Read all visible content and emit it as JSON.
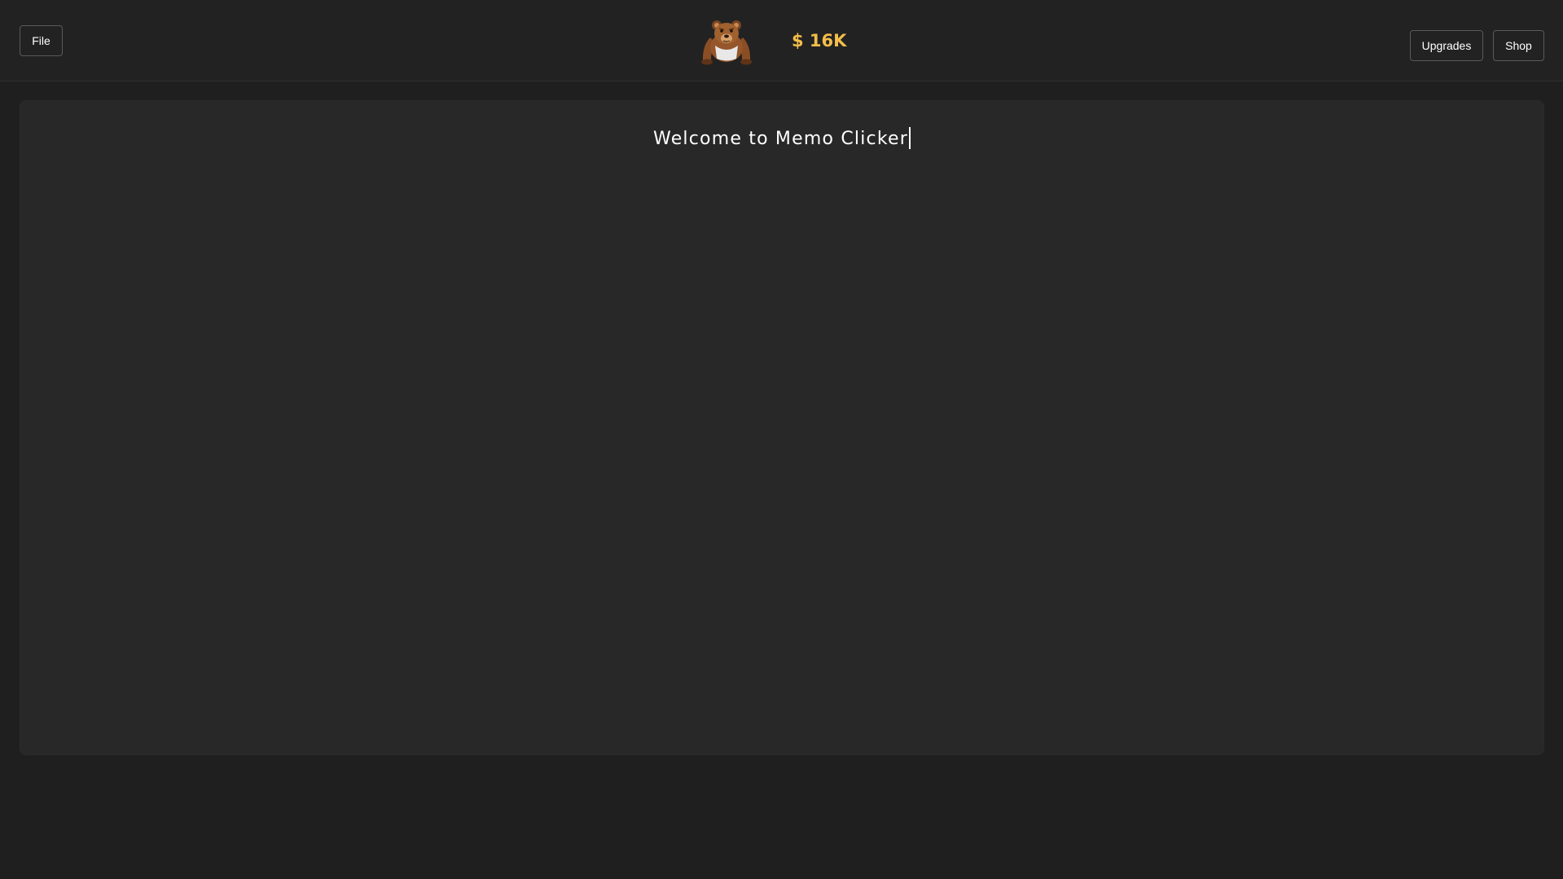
{
  "header": {
    "file_label": "File",
    "money": "$ 16K",
    "upgrades_label": "Upgrades",
    "shop_label": "Shop",
    "bear_icon": "bear-icon"
  },
  "editor": {
    "text": "Welcome to Memo Clicker"
  },
  "colors": {
    "background": "#1f1f1f",
    "topbar": "#222222",
    "editor_background": "#282828",
    "money": "#f2bd4a",
    "text": "#ffffff"
  }
}
